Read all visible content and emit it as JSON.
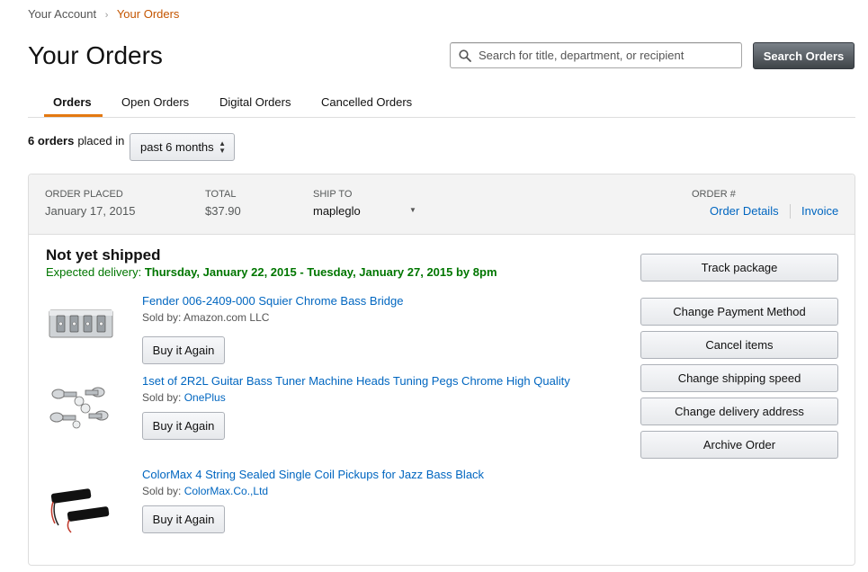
{
  "breadcrumb": {
    "parent": "Your Account",
    "separator": "›",
    "current": "Your Orders"
  },
  "page_title": "Your Orders",
  "search": {
    "placeholder": "Search for title, department, or recipient",
    "value": "",
    "button_label": "Search Orders"
  },
  "tabs": [
    {
      "label": "Orders",
      "active": true
    },
    {
      "label": "Open Orders",
      "active": false
    },
    {
      "label": "Digital Orders",
      "active": false
    },
    {
      "label": "Cancelled Orders",
      "active": false
    }
  ],
  "filter": {
    "count_text": "6 orders",
    "placed_text": "placed in",
    "period": "past 6 months"
  },
  "order": {
    "placed_label": "ORDER PLACED",
    "placed_value": "January 17, 2015",
    "total_label": "TOTAL",
    "total_value": "$37.90",
    "ship_to_label": "SHIP TO",
    "ship_to_value": "mapleglo",
    "order_number_label": "ORDER #",
    "order_details_link": "Order Details",
    "invoice_link": "Invoice",
    "status": "Not yet shipped",
    "expected_prefix": "Expected delivery:",
    "expected_dates": "Thursday, January 22, 2015 - Tuesday, January 27, 2015 by 8pm",
    "items": [
      {
        "title": "Fender 006-2409-000 Squier Chrome Bass Bridge",
        "sold_by_label": "Sold by:",
        "seller": "Amazon.com LLC",
        "seller_is_link": false,
        "buy_again": "Buy it Again",
        "image_icon": "bass-bridge-image"
      },
      {
        "title": "1set of 2R2L Guitar Bass Tuner Machine Heads Tuning Pegs Chrome High Quality",
        "sold_by_label": "Sold by:",
        "seller": "OnePlus",
        "seller_is_link": true,
        "buy_again": "Buy it Again",
        "image_icon": "tuning-pegs-image"
      },
      {
        "title": "ColorMax 4 String Sealed Single Coil Pickups for Jazz Bass Black",
        "sold_by_label": "Sold by:",
        "seller": "ColorMax.Co.,Ltd",
        "seller_is_link": true,
        "buy_again": "Buy it Again",
        "image_icon": "pickups-image"
      }
    ],
    "actions": [
      "Track package",
      "Change Payment Method",
      "Cancel items",
      "Change shipping speed",
      "Change delivery address",
      "Archive Order"
    ]
  },
  "colors": {
    "accent": "#e47911",
    "link": "#0066c0",
    "breadcrumb_current": "#c45500",
    "delivery_green": "#007600"
  }
}
